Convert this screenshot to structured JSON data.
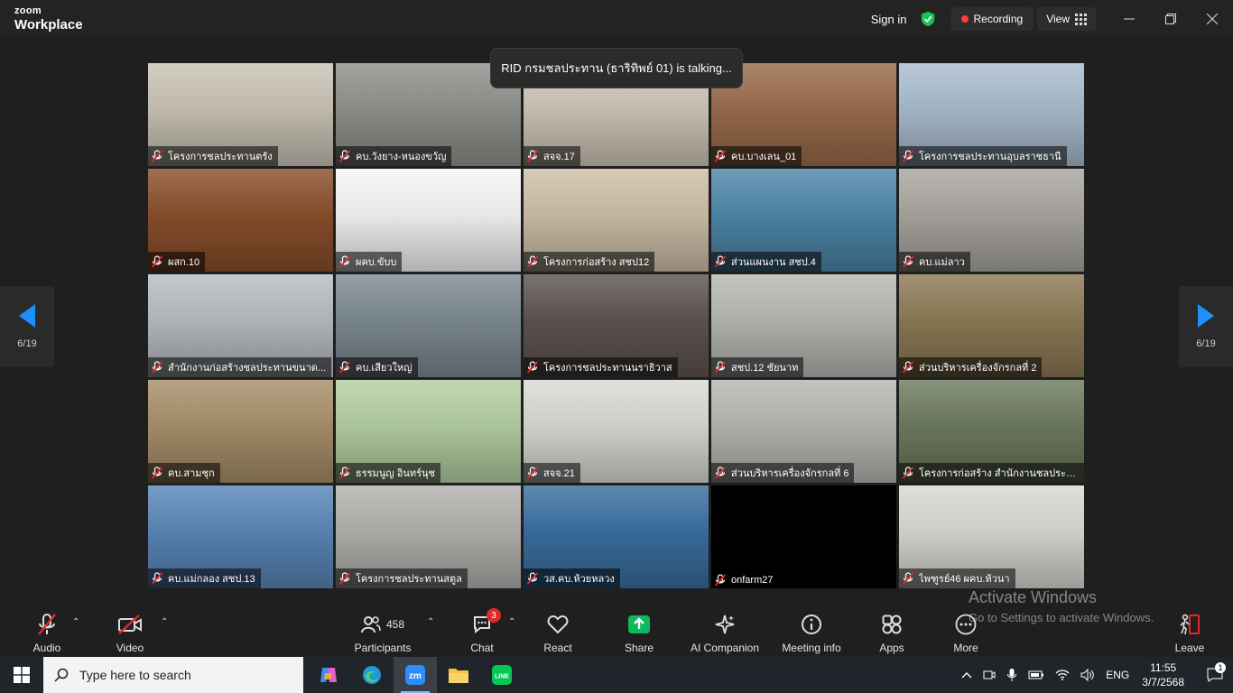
{
  "app": {
    "brand_top": "zoom",
    "brand_bottom": "Workplace"
  },
  "titlebar": {
    "sign_in": "Sign in",
    "recording": "Recording",
    "view": "View"
  },
  "toast": "RID กรมชลประทาน (ธาริทิพย์ 01) is talking...",
  "pager": {
    "left": "6/19",
    "right": "6/19"
  },
  "participants": [
    {
      "name": "โครงการชลประทานตรัง",
      "bg": "#c9c2b4"
    },
    {
      "name": "คบ.วังยาง-หนองขวัญ",
      "bg": "#8e918c"
    },
    {
      "name": "สจจ.17",
      "bg": "#cfc5b6"
    },
    {
      "name": "คบ.บางเลน_01",
      "bg": "#9a6b4b"
    },
    {
      "name": "โครงการชลประทานอุบลราชธานี",
      "bg": "#a9bccd"
    },
    {
      "name": "ผสก.10",
      "bg": "#8a4f2c"
    },
    {
      "name": "ผคบ.ขับบ",
      "bg": "#f4f4f4"
    },
    {
      "name": "โครงการก่อสร้าง สชป12",
      "bg": "#cdbfa8"
    },
    {
      "name": "ส่วนแผนงาน สชป.4",
      "bg": "#4d86a8"
    },
    {
      "name": "คบ.แม่ลาว",
      "bg": "#a9a6a0"
    },
    {
      "name": "สำนักงานก่อสร้างชลประทานขนาด...",
      "bg": "#b7bcc2"
    },
    {
      "name": "คบ.เสียวใหญ่",
      "bg": "#7d8a92"
    },
    {
      "name": "โครงการชลประทานนราธิวาส",
      "bg": "#5d5450"
    },
    {
      "name": "สชป.12 ชัยนาท",
      "bg": "#b6b8b3"
    },
    {
      "name": "ส่วนบริหารเครื่องจักรกลที่ 2",
      "bg": "#8d7a55"
    },
    {
      "name": "คบ.สามชุก",
      "bg": "#a88f6a"
    },
    {
      "name": "ธรรมนูญ อินทร์นุช",
      "bg": "#b4cfa3"
    },
    {
      "name": "สจจ.21",
      "bg": "#d9d9d4"
    },
    {
      "name": "ส่วนบริหารเครื่องจักรกลที่ 6",
      "bg": "#b8b6b3"
    },
    {
      "name": "โครงการก่อสร้าง สำนักงานชลประท...",
      "bg": "#6d7a5e"
    },
    {
      "name": "คบ.แม่กลอง สชป.13",
      "bg": "#5a86b8"
    },
    {
      "name": "โครงการชลประทานสตูล",
      "bg": "#b3b1ae"
    },
    {
      "name": "วส.คบ.ห้วยหลวง",
      "bg": "#3a6fa0"
    },
    {
      "name": "onfarm27",
      "bg": "#000000"
    },
    {
      "name": "ไพฑูรย์46 ผคบ.ห้วนา",
      "bg": "#d9d7d2"
    }
  ],
  "toolbar": {
    "audio": "Audio",
    "video": "Video",
    "participants": "Participants",
    "participants_count": "458",
    "chat": "Chat",
    "chat_badge": "3",
    "react": "React",
    "share": "Share",
    "ai": "AI Companion",
    "info": "Meeting info",
    "apps": "Apps",
    "more": "More",
    "leave": "Leave"
  },
  "watermark": {
    "title": "Activate Windows",
    "sub": "Go to Settings to activate Windows."
  },
  "taskbar": {
    "search_placeholder": "Type here to search",
    "lang": "ENG",
    "time": "11:55",
    "date": "3/7/2568",
    "notif_count": "1"
  },
  "colors": {
    "share_green": "#0bb85c",
    "recording_red": "#ff3b3b",
    "nav_blue": "#1e8fff"
  }
}
